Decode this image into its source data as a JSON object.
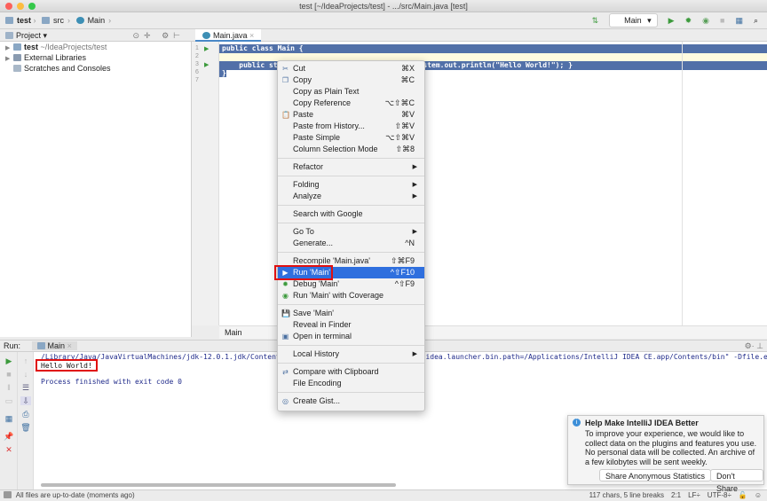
{
  "window": {
    "title": "test [~/IdeaProjects/test] - .../src/Main.java [test]"
  },
  "navbar": {
    "crumbs": [
      "test",
      "src",
      "Main"
    ],
    "run_config": "Main"
  },
  "project": {
    "header": "Project",
    "tree": [
      {
        "name": "test",
        "path": "~/IdeaProjects/test"
      },
      {
        "name": "External Libraries"
      },
      {
        "name": "Scratches and Consoles"
      }
    ]
  },
  "editor": {
    "tab": "Main.java",
    "line_numbers": [
      "1",
      "2",
      "3",
      "6",
      "7"
    ],
    "lines": [
      "public class Main {",
      "",
      "    public static void main(String[] args) { System.out.println(\"Hello World!\"); }",
      "}"
    ],
    "breadcrumb": "Main"
  },
  "context_menu": {
    "groups": [
      [
        {
          "label": "Cut",
          "shortcut": "⌘X",
          "icon": "cut-icon"
        },
        {
          "label": "Copy",
          "shortcut": "⌘C",
          "icon": "copy-icon"
        },
        {
          "label": "Copy as Plain Text",
          "shortcut": ""
        },
        {
          "label": "Copy Reference",
          "shortcut": "⌥⇧⌘C"
        },
        {
          "label": "Paste",
          "shortcut": "⌘V",
          "icon": "paste-icon"
        },
        {
          "label": "Paste from History...",
          "shortcut": "⇧⌘V"
        },
        {
          "label": "Paste Simple",
          "shortcut": "⌥⇧⌘V"
        },
        {
          "label": "Column Selection Mode",
          "shortcut": "⇧⌘8"
        }
      ],
      [
        {
          "label": "Refactor",
          "submenu": true
        }
      ],
      [
        {
          "label": "Folding",
          "submenu": true
        },
        {
          "label": "Analyze",
          "submenu": true
        }
      ],
      [
        {
          "label": "Search with Google"
        }
      ],
      [
        {
          "label": "Go To",
          "submenu": true
        },
        {
          "label": "Generate...",
          "shortcut": "^N"
        }
      ],
      [
        {
          "label": "Recompile 'Main.java'",
          "shortcut": "⇧⌘F9"
        },
        {
          "label": "Run 'Main'",
          "shortcut": "^⇧F10",
          "icon": "run-icon",
          "highlighted": true
        },
        {
          "label": "Debug 'Main'",
          "shortcut": "^⇧F9",
          "icon": "debug-icon"
        },
        {
          "label": "Run 'Main' with Coverage",
          "icon": "coverage-icon"
        }
      ],
      [
        {
          "label": "Save 'Main'",
          "icon": "save-icon"
        },
        {
          "label": "Reveal in Finder"
        },
        {
          "label": "Open in terminal",
          "icon": "terminal-icon"
        }
      ],
      [
        {
          "label": "Local History",
          "submenu": true
        }
      ],
      [
        {
          "label": "Compare with Clipboard",
          "icon": "compare-icon"
        },
        {
          "label": "File Encoding"
        }
      ],
      [
        {
          "label": "Create Gist...",
          "icon": "github-icon"
        }
      ]
    ]
  },
  "run": {
    "label": "Run:",
    "tab": "Main",
    "console": [
      "/Library/Java/JavaVirtualMachines/jdk-12.0.1.jdk/Contents/Home/bin/java \"-javaagent:... -Didea.launcher.bin.path=/Applications/IntelliJ IDEA CE.app/Contents/bin\" -Dfile.encodi",
      "Hello World!",
      "",
      "Process finished with exit code 0"
    ]
  },
  "notification": {
    "title": "Help Make IntelliJ IDEA Better",
    "body": "To improve your experience, we would like to collect data on the plugins and features you use. No personal data will be collected. An archive of a few kilobytes will be sent weekly.",
    "share": "Share Anonymous Statistics",
    "dont_share": "Don't Share"
  },
  "status": {
    "message": "All files are up-to-date (moments ago)",
    "chars": "117 chars, 5 line breaks",
    "position": "2:1",
    "line_sep": "LF÷",
    "encoding": "UTF-8÷"
  },
  "colors": {
    "selection": "#5170a8",
    "highlight": "#2f6fde",
    "annotation": "#e01010"
  }
}
